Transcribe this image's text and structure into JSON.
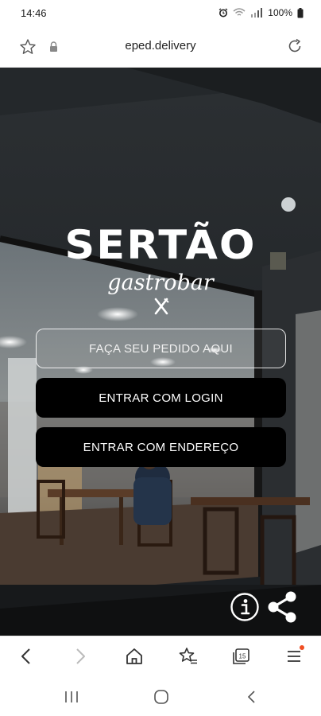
{
  "status_bar": {
    "time": "14:46",
    "battery": "100%",
    "icons": [
      "alarm-icon",
      "wifi-icon",
      "signal-icon",
      "battery-icon"
    ]
  },
  "browser": {
    "url": "eped.delivery",
    "icons": [
      "bookmark-star-icon",
      "lock-icon",
      "reload-icon"
    ]
  },
  "brand": {
    "name": "SERTÃO",
    "tagline": "gastrobar",
    "icon": "crossed-cutlery-icon"
  },
  "actions": {
    "order_label": "FAÇA SEU PEDIDO AQUI",
    "login_label": "ENTRAR COM LOGIN",
    "address_label": "ENTRAR COM ENDEREÇO"
  },
  "floating": {
    "info_icon": "info-icon",
    "share_icon": "share-icon"
  },
  "toolbar": {
    "tab_count": "15",
    "items": [
      "back-icon",
      "forward-icon",
      "home-icon",
      "bookmarks-icon",
      "tabs-icon",
      "menu-icon"
    ]
  },
  "system_nav": {
    "items": [
      "recents-icon",
      "home-circle-icon",
      "back-chevron-icon"
    ]
  },
  "colors": {
    "button_dark": "#000000",
    "notification_dot": "#f04e23",
    "hero_bg": "#1d2124"
  }
}
